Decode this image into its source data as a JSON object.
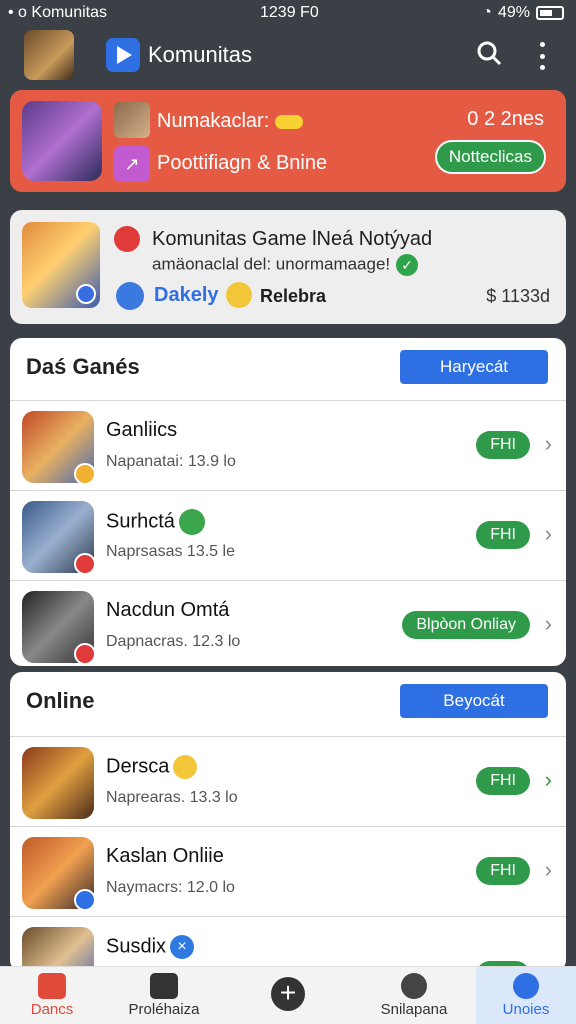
{
  "status": {
    "left": "• o Komunitas",
    "time": "1239 F0",
    "battery": "49%"
  },
  "header": {
    "title": "Komunitas"
  },
  "banner": {
    "line1": "Numakaclar:",
    "line2": "Poottifiagn & Bnine",
    "count": "0 2 2nes",
    "button": "Notteclicas"
  },
  "notification": {
    "title": "Komunitas Game lNeá Notýyad",
    "subtitle": "amäonaclal del: unormamaage!",
    "user": "Dakely",
    "label": "Relebra",
    "price": "$ 1133d"
  },
  "section1": {
    "title": "Daś Ganés",
    "button": "Haryecát",
    "rows": [
      {
        "name": "Ganliics",
        "meta": "Napanatai: 13.9 lo",
        "tag": "FHI"
      },
      {
        "name": "Surhctá",
        "meta": "Naprsasas 13.5 le",
        "tag": "FHI"
      },
      {
        "name": "Nacdun Omtá",
        "meta": "Dapnacras. 12.3 lo",
        "tag": "Blpòon Onliay"
      }
    ]
  },
  "section2": {
    "title": "Online",
    "button": "Beyocát",
    "rows": [
      {
        "name": "Dersca",
        "meta": "Naprearas. 13.3 lo",
        "tag": "FHI"
      },
      {
        "name": "Kaslan Onliie",
        "meta": "Naymacrs: 12.0 lo",
        "tag": "FHI"
      },
      {
        "name": "Susdix",
        "meta": "",
        "tag": "FHI"
      }
    ]
  },
  "nav": {
    "items": [
      "Dancs",
      "Proléhaiza",
      "",
      "Snilapana",
      "Unoies"
    ]
  }
}
